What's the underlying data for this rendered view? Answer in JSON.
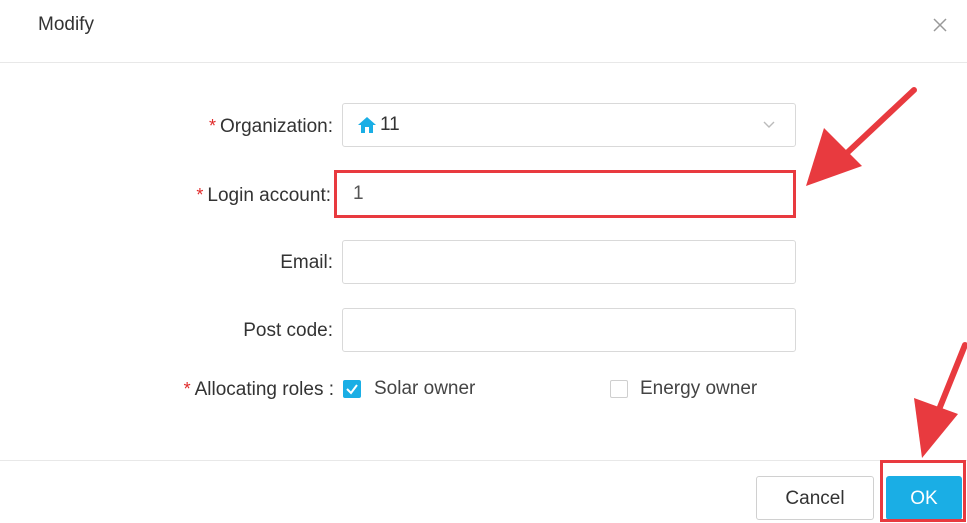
{
  "dialog": {
    "title": "Modify",
    "close_icon": "close-icon"
  },
  "form": {
    "organization": {
      "label": "Organization:",
      "required": "*",
      "value": "11",
      "icon": "home-icon"
    },
    "login_account": {
      "label": "Login account:",
      "required": "*",
      "value": "1"
    },
    "email": {
      "label": "Email:",
      "value": ""
    },
    "post_code": {
      "label": "Post code:",
      "value": ""
    },
    "roles": {
      "label": "Allocating roles :",
      "required": "*",
      "options": [
        {
          "label": "Solar owner",
          "checked": true
        },
        {
          "label": "Energy owner",
          "checked": false
        }
      ]
    }
  },
  "footer": {
    "cancel_label": "Cancel",
    "ok_label": "OK"
  },
  "colors": {
    "accent": "#1aaee5",
    "required": "#e02a2a",
    "annotation": "#e83a3f"
  }
}
